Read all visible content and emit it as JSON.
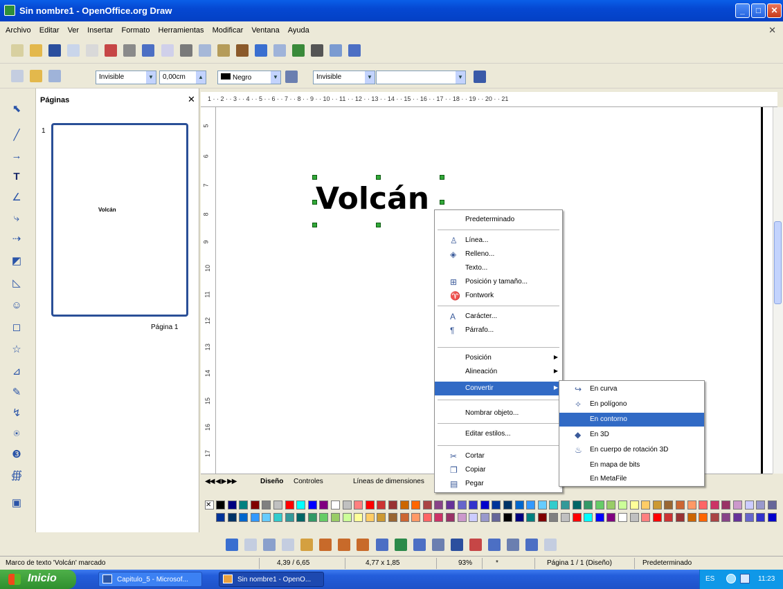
{
  "window": {
    "title": "Sin nombre1 - OpenOffice.org Draw",
    "min": "_",
    "max": "□",
    "close": "✕",
    "doc_close": "✕"
  },
  "menubar": [
    "Archivo",
    "Editar",
    "Ver",
    "Insertar",
    "Formato",
    "Herramientas",
    "Modificar",
    "Ventana",
    "Ayuda"
  ],
  "toolbar2": {
    "line_style": "Invisible",
    "line_width": "0,00cm",
    "line_color": "Negro",
    "area_style": "Invisible"
  },
  "pages_panel": {
    "title": "Páginas",
    "close": "✕",
    "page_number": "1",
    "thumbnail_text": "Volcán",
    "page_label": "Página 1"
  },
  "ruler_top": "1 · · 2 · · 3 · · 4 · · 5 · · 6 · · 7 · · 8 · · 9 · · 10 · · 11 · · 12 · · 13 · · 14 · · 15 · · 16 · · 17 · · 18 · · 19 · · 20 · · 21",
  "ruler_left": [
    "5",
    "6",
    "7",
    "8",
    "9",
    "10",
    "11",
    "12",
    "13",
    "14",
    "15",
    "16",
    "17"
  ],
  "canvas": {
    "text": "Volcán"
  },
  "tabs": {
    "nav": "◀◀ ◀ ▶ ▶▶",
    "design": "Diseño",
    "controls": "Controles",
    "dimensions": "Líneas de dimensiones"
  },
  "context_menu": [
    {
      "label": "Predeterminado",
      "icon": ""
    },
    {
      "label": "Línea...",
      "icon": "line-icon"
    },
    {
      "label": "Relleno...",
      "icon": "fill-icon"
    },
    {
      "label": "Texto...",
      "icon": ""
    },
    {
      "label": "Posición y tamaño...",
      "icon": "position-icon"
    },
    {
      "label": "Fontwork",
      "icon": "fontwork-icon"
    },
    {
      "label": "Carácter...",
      "icon": "character-icon"
    },
    {
      "label": "Párrafo...",
      "icon": "paragraph-icon"
    },
    {
      "label": "Posición",
      "icon": ""
    },
    {
      "label": "Alineación",
      "icon": ""
    },
    {
      "label": "Convertir",
      "icon": ""
    },
    {
      "label": "Nombrar objeto...",
      "icon": ""
    },
    {
      "label": "Editar estilos...",
      "icon": ""
    },
    {
      "label": "Cortar",
      "icon": "scissors-icon"
    },
    {
      "label": "Copiar",
      "icon": "copy-icon"
    },
    {
      "label": "Pegar",
      "icon": "paste-icon"
    }
  ],
  "submenu": [
    {
      "label": "En curva",
      "icon": "curve-icon"
    },
    {
      "label": "En polígono",
      "icon": "polygon-icon"
    },
    {
      "label": "En contorno",
      "icon": ""
    },
    {
      "label": "En 3D",
      "icon": "3d-icon"
    },
    {
      "label": "En cuerpo de rotación 3D",
      "icon": "rotation-icon"
    },
    {
      "label": "En mapa de bits",
      "icon": ""
    },
    {
      "label": "En MetaFile",
      "icon": ""
    }
  ],
  "palette_colors": [
    "#000000",
    "#000080",
    "#008080",
    "#800000",
    "#808080",
    "#c0c0c0",
    "#ff0000",
    "#00ffff",
    "#0000ff",
    "#800080",
    "#ffffff",
    "#c0c0c0",
    "#ff8080",
    "#ff0000",
    "#cc3333",
    "#993333",
    "#cc6600",
    "#ff6600",
    "#aa4444",
    "#884488",
    "#663399",
    "#6666cc",
    "#3333cc",
    "#0000cc",
    "#003399",
    "#003366",
    "#0066cc",
    "#3399ff",
    "#66ccff",
    "#33cccc",
    "#339999",
    "#006666",
    "#339966",
    "#66cc66",
    "#99cc66",
    "#ccff99",
    "#ffff99",
    "#ffcc66",
    "#cc9933",
    "#996633",
    "#cc6633",
    "#ff9966",
    "#ff6666",
    "#cc3366",
    "#993366",
    "#cc99cc",
    "#ccccff",
    "#9999cc",
    "#666699"
  ],
  "status": {
    "message": "Marco de texto 'Volcán' marcado",
    "position": "4,39 / 6,65",
    "size": "4,77 x 1,85",
    "zoom": "93%",
    "modified": "*",
    "page": "Página 1 / 1 (Diseño)",
    "style": "Predeterminado"
  },
  "taskbar": {
    "start": "Inicio",
    "tasks": [
      "Capitulo_5 - Microsof...",
      "Sin nombre1 - OpenO..."
    ],
    "lang": "ES",
    "clock": "11:23"
  }
}
